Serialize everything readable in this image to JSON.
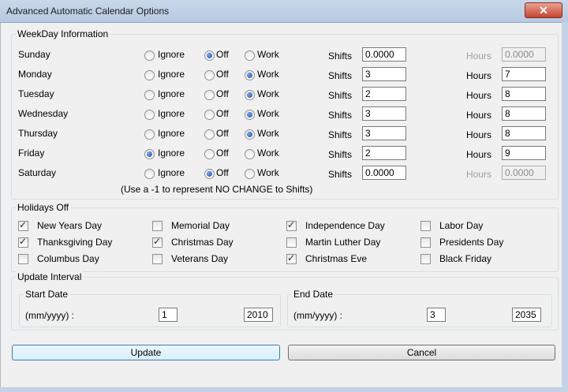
{
  "window": {
    "title": "Advanced Automatic Calendar Options",
    "close_glyph": "✕"
  },
  "weekday": {
    "legend": "WeekDay Information",
    "option_labels": [
      "Ignore",
      "Off",
      "Work"
    ],
    "shifts_label": "Shifts",
    "hours_label": "Hours",
    "note": "(Use a -1 to represent NO CHANGE to Shifts)",
    "days": [
      {
        "name": "Sunday",
        "selected": "Off",
        "shifts": "0.0000",
        "hours": "0.0000",
        "hours_enabled": false
      },
      {
        "name": "Monday",
        "selected": "Work",
        "shifts": "3",
        "hours": "7",
        "hours_enabled": true
      },
      {
        "name": "Tuesday",
        "selected": "Work",
        "shifts": "2",
        "hours": "8",
        "hours_enabled": true
      },
      {
        "name": "Wednesday",
        "selected": "Work",
        "shifts": "3",
        "hours": "8",
        "hours_enabled": true
      },
      {
        "name": "Thursday",
        "selected": "Work",
        "shifts": "3",
        "hours": "8",
        "hours_enabled": true
      },
      {
        "name": "Friday",
        "selected": "Ignore",
        "shifts": "2",
        "hours": "9",
        "hours_enabled": true
      },
      {
        "name": "Saturday",
        "selected": "Off",
        "shifts": "0.0000",
        "hours": "0.0000",
        "hours_enabled": false
      }
    ]
  },
  "holidays": {
    "legend": "Holidays Off",
    "items": [
      {
        "label": "New Years Day",
        "checked": true
      },
      {
        "label": "Memorial Day",
        "checked": false
      },
      {
        "label": "Independence Day",
        "checked": true
      },
      {
        "label": "Labor Day",
        "checked": false
      },
      {
        "label": "Thanksgiving Day",
        "checked": true
      },
      {
        "label": "Christmas Day",
        "checked": true
      },
      {
        "label": "Martin Luther Day",
        "checked": false
      },
      {
        "label": "Presidents Day",
        "checked": false
      },
      {
        "label": "Columbus Day",
        "checked": false
      },
      {
        "label": "Veterans Day",
        "checked": false
      },
      {
        "label": "Christmas Eve",
        "checked": true
      },
      {
        "label": "Black Friday",
        "checked": false
      }
    ]
  },
  "interval": {
    "legend": "Update Interval",
    "start": {
      "legend": "Start Date",
      "format_label": "(mm/yyyy) :",
      "month": "1",
      "year": "2010"
    },
    "end": {
      "legend": "End Date",
      "format_label": "(mm/yyyy) :",
      "month": "3",
      "year": "2035"
    }
  },
  "buttons": {
    "update": "Update",
    "cancel": "Cancel"
  }
}
